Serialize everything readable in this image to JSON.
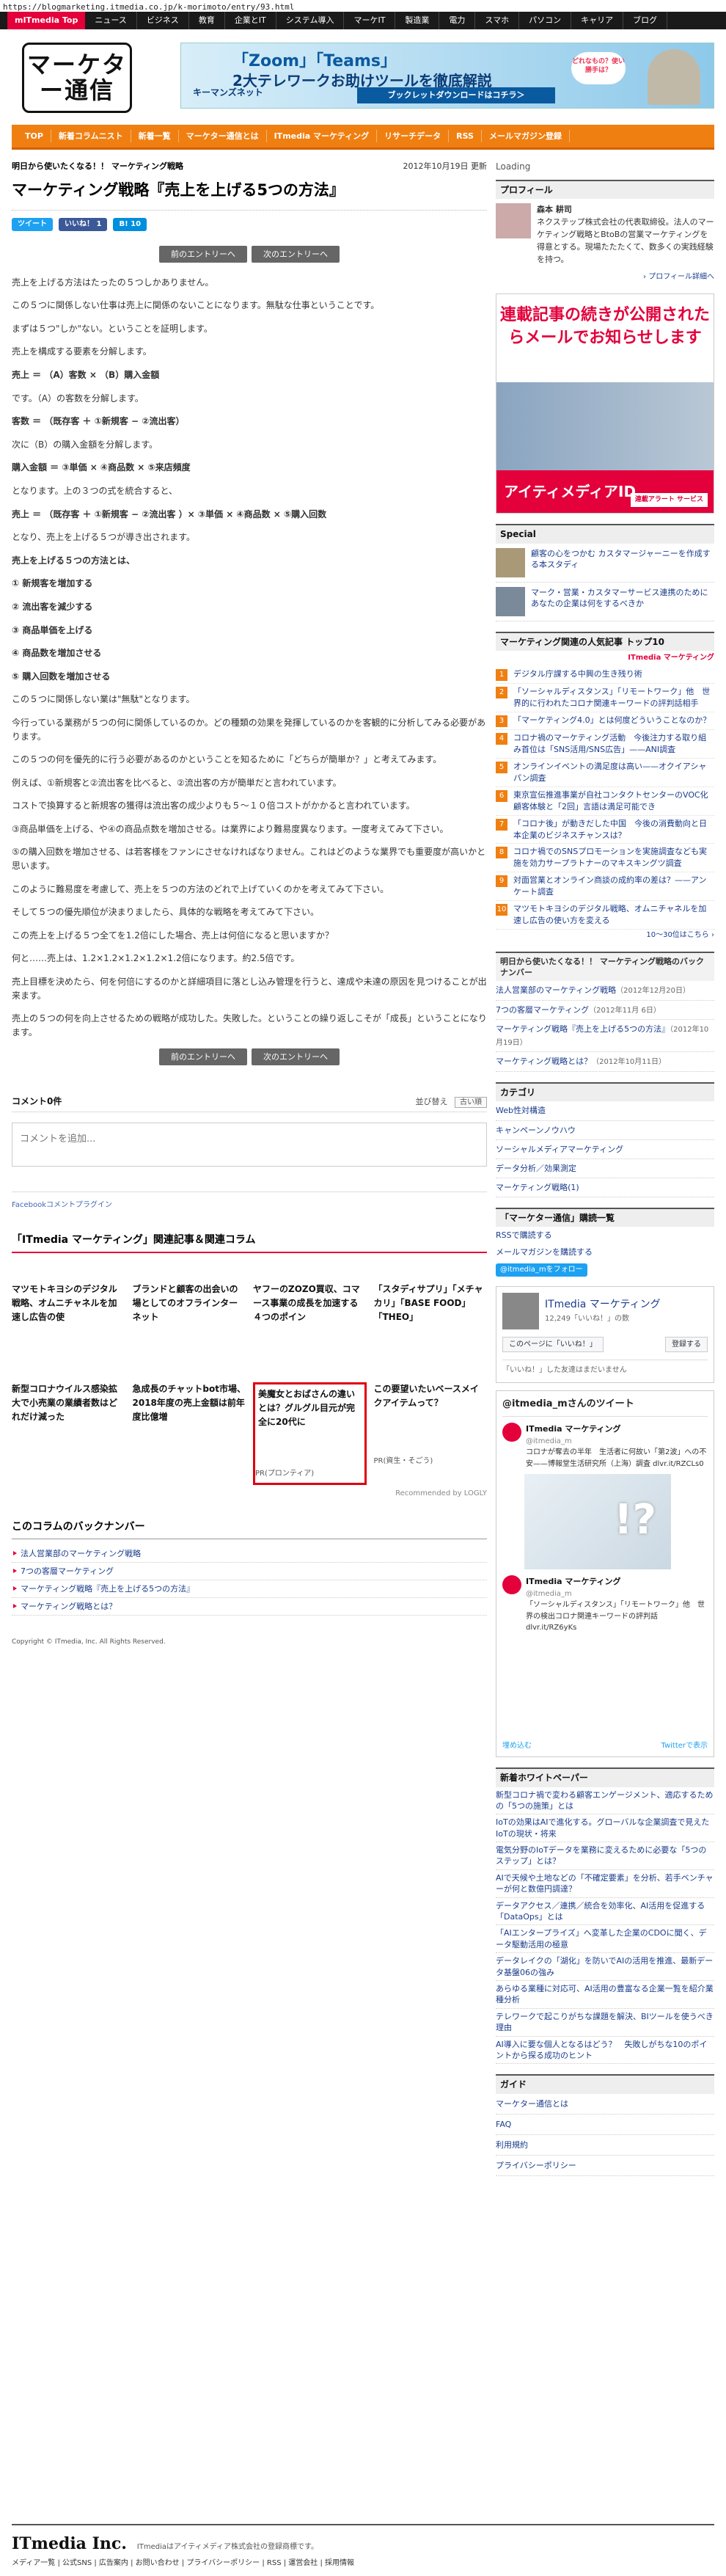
{
  "url": "https://blogmarketing.itmedia.co.jp/k-morimoto/entry/93.html",
  "topnav": {
    "home": "mITmedia Top",
    "links": [
      "ニュース",
      "ビジネス",
      "教育",
      "企業とIT",
      "システム導入",
      "マーケIT",
      "製造業",
      "電力",
      "スマホ",
      "パソコン",
      "キャリア",
      "ブログ"
    ]
  },
  "logo": "マーケター通信",
  "banner_top": {
    "line1": "「Zoom」「Teams」",
    "line2": "2大テレワークお助けツールを徹底解説",
    "brand": "キーマンズネット",
    "cta": "ブックレットダウンロードはコチラ＞",
    "bubble": "どれなもの？使い勝手は？"
  },
  "catnav": [
    "TOP",
    "新着コラムニスト",
    "新着一覧",
    "マーケター通信とは",
    "ITmedia マーケティング",
    "リサーチデータ",
    "RSS",
    "メールマガジン登録"
  ],
  "article": {
    "subtitle": "明日から使いたくなる！！ マーケティング戦略",
    "date": "2012年10月19日 更新",
    "title": "マーケティング戦略『売上を上げる5つの方法』",
    "share": {
      "tweet": "ツイート",
      "like": "いいね！ 1",
      "hatena": "B! 10"
    },
    "prev": "前のエントリーへ",
    "next": "次のエントリーへ",
    "paragraphs": [
      {
        "t": "売上を上げる方法はたったの５つしかありません。",
        "b": false
      },
      {
        "t": "この５つに関係しない仕事は売上に関係のないことになります。無駄な仕事ということです。",
        "b": false
      },
      {
        "t": "まずは５つ\"しか\"ない。ということを証明します。",
        "b": false
      },
      {
        "t": "売上を構成する要素を分解します。",
        "b": false
      },
      {
        "t": "売上 ＝ （A）客数 × （B）購入金額",
        "b": true
      },
      {
        "t": "です。（A）の客数を分解します。",
        "b": false
      },
      {
        "t": "客数 ＝ （既存客 ＋ ①新規客 − ②流出客）",
        "b": true
      },
      {
        "t": "次に（B）の購入金額を分解します。",
        "b": false
      },
      {
        "t": "購入金額 ＝ ③単価 × ④商品数 × ⑤来店頻度",
        "b": true
      },
      {
        "t": "となります。上の３つの式を統合すると、",
        "b": false
      },
      {
        "t": "売上 ＝ （既存客 ＋ ①新規客 − ②流出客 ）× ③単価 × ④商品数 × ⑤購入回数",
        "b": true
      },
      {
        "t": "となり、売上を上げる５つが導き出されます。",
        "b": false
      },
      {
        "t": "売上を上げる５つの方法とは、",
        "b": true
      },
      {
        "t": "① 新規客を増加する",
        "b": true
      },
      {
        "t": "② 流出客を減少する",
        "b": true
      },
      {
        "t": "③ 商品単価を上げる",
        "b": true
      },
      {
        "t": "④ 商品数を増加させる",
        "b": true
      },
      {
        "t": "⑤ 購入回数を増加させる",
        "b": true
      },
      {
        "t": "この５つに関係しない業は\"無駄\"となります。",
        "b": false
      },
      {
        "t": "今行っている業務が５つの何に関係しているのか。どの種類の効果を発揮しているのかを客観的に分析してみる必要があります。",
        "b": false
      },
      {
        "t": "この５つの何を優先的に行う必要があるのかということを知るために「どちらが簡単か？」と考えてみます。",
        "b": false
      },
      {
        "t": "例えば、①新規客と②流出客を比べると、②流出客の方が簡単だと言われています。",
        "b": false
      },
      {
        "t": "コストで換算すると新規客の獲得は流出客の成少よりも５〜１０倍コストがかかると言われています。",
        "b": false
      },
      {
        "t": "③商品単価を上げる、や④の商品点数を増加させる。は業界により難易度異なります。一度考えてみて下さい。",
        "b": false
      },
      {
        "t": "⑤の購入回数を増加させる、は若客様をファンにさせなければなりません。これはどのような業界でも重要度が高いかと思います。",
        "b": false
      },
      {
        "t": "このように難易度を考慮して、売上を５つの方法のどれで上げていくのかを考えてみて下さい。",
        "b": false
      },
      {
        "t": "そして５つの優先順位が決まりましたら、具体的な戦略を考えてみて下さい。",
        "b": false
      },
      {
        "t": "この売上を上げる５つ全てを1.2倍にした場合、売上は何倍になると思いますか？",
        "b": false
      },
      {
        "t": "何と……売上は、1.2×1.2×1.2×1.2×1.2倍になります。約2.5倍です。",
        "b": false
      },
      {
        "t": "売上目標を決めたら、何を何倍にするのかと詳細項目に落とし込み管理を行うと、達成や未達の原因を見つけることが出来ます。",
        "b": false
      },
      {
        "t": "売上の５つの何を向上させるための戦略が成功した。失敗した。ということの繰り返しこそが「成長」ということになります。",
        "b": false
      }
    ]
  },
  "comments": {
    "count": "コメント0件",
    "sort_label": "並び替え",
    "sort_value": "古い順",
    "placeholder": "コメントを追加...",
    "plugin": "Facebookコメントプラグイン"
  },
  "related": {
    "title": "「ITmedia マーケティング」関連記事＆関連コラム",
    "items": [
      {
        "t": "マツモトキヨシのデジタル戦略、オムニチャネルを加速し広告の使",
        "s": ""
      },
      {
        "t": "ブランドと顧客の出会いの場としてのオフラインターネット",
        "s": ""
      },
      {
        "t": "ヤフーのZOZO買収、コマース事業の成長を加速する４つのポイン",
        "s": ""
      },
      {
        "t": "「スタディサプリ」「メチャカリ」「BASE FOOD」「THEO」",
        "s": ""
      },
      {
        "t": "新型コロナウイルス感染拡大で小売業の業績者数はどれだけ減った",
        "s": ""
      },
      {
        "t": "急成長のチャットbot市場、2018年度の売上金額は前年度比億増",
        "s": ""
      },
      {
        "t": "美魔女とおばさんの違いとは？グルグル目元が完全に20代に",
        "s": "PR(プロンティア)"
      },
      {
        "t": "この要望いたいベースメイクアイテムって？",
        "s": "PR(資生・そごう)"
      }
    ],
    "recommend": "Recommended by  LOGLY"
  },
  "backnum": {
    "title": "このコラムのバックナンバー",
    "items": [
      "法人営業部のマーケティング戦略",
      "7つの客層マーケティング",
      "マーケティング戦略『売上を上げる5つの方法』",
      "マーケティング戦略とは？"
    ]
  },
  "copyright": "Copyright © ITmedia, Inc. All Rights Reserved.",
  "side": {
    "loading": "Loading",
    "profile_head": "プロフィール",
    "profile_name": "森本 耕司",
    "profile_text": "ネクステップ株式会社の代表取締役。法人のマーケティング戦略とBtoBの営業マーケティングを得意とする。現場たたたくて、数多くの実践経験を持つ。",
    "profile_more": "› プロフィール詳細へ",
    "ad_top": "連載記事の続きが公開されたらメールでお知らせします",
    "ad_bottom": "アイティメディアID",
    "ad_badge": "連載アラート サービス",
    "special_head": "Special",
    "special": [
      "顧客の心をつかむ カスタマージャーニーを作成する本スタディ",
      "マーク・営業・カスタマーサービス連携のためにあなたの企業は何をするべきか"
    ],
    "rank_head": "マーケティング関連の人気記事 トップ10",
    "rank_brand": "ITmedia マーケティング",
    "rank": [
      "デジタル庁課する中興の生き残り術",
      "「ソーシャルディスタンス」「リモートワーク」他　世界的に行われたコロナ関連キーワードの評判話相手",
      "「マーケティング4.0」とは何度どういうことなのか？",
      "コロナ禍のマーケティング活動　今後注力する取り組み首位は「SNS活用/SNS広告」——ANI調査",
      "オンラインイベントの満足度は高い——オクイアシャパン調査",
      "東京宣伝推進事業が自社コンタクトセンターのVOC化　顧客体験と「2回」言語は満足可能でき",
      "「コロナ後」が動きだした中国　今後の消費動向と日本企業のビジネスチャンスは？",
      "コロナ禍でのSNSプロモーションを実施調査なども実施を効力サープラトナーのマキスキングツ調査",
      "対面営業とオンライン商談の成約率の差は？——アンケート調査",
      "マツモトキヨシのデジタル戦略、オムニチャネルを加速し広告の使い方を変える"
    ],
    "rank_more": "10～30位はこちら ›",
    "series_head": "明日から使いたくなる！！ マーケティング戦略のバックナンバー",
    "series": [
      {
        "t": "法人営業部のマーケティング戦略",
        "d": "（2012年12月20日）"
      },
      {
        "t": "7つの客層マーケティング",
        "d": "（2012年11月 6日）"
      },
      {
        "t": "マーケティング戦略『売上を上げる5つの方法』",
        "d": "（2012年10月19日）"
      },
      {
        "t": "マーケティング戦略とは？",
        "d": "（2012年10月11日）"
      }
    ],
    "category_head": "カテゴリ",
    "categories": [
      "Web性対構造",
      "キャンペーンノウハウ",
      "ソーシャルメディアマーケティング",
      "データ分析／効果測定",
      "マーケティング戦略(1)"
    ],
    "sub_head": "「マーケター通信」購読一覧",
    "subs": [
      "RSSで購読する",
      "メールマガジンを購読する"
    ],
    "tw_follow": "@itmedia_mをフォロー",
    "fb_name": "ITmedia マーケティング",
    "fb_count": "12,249「いいね！」の数",
    "fb_like": "このページに「いいね！」",
    "fb_share": "登録する",
    "fb_note": "「いいね！」した友達はまだいません",
    "tw_head": "@itmedia_mさんのツイート",
    "tweets": [
      {
        "name": "ITmedia マーケティング",
        "handle": "@itmedia_m",
        "text": "コロナが奪去の半年　生活者に何故い「第2波」への不安——博報堂生活研究所（上海）調査 dlvr.it/RZCLs0"
      },
      {
        "name": "ITmedia マーケティング",
        "handle": "@itmedia_m",
        "text": "「ソーシャルディスタンス」「リモートワーク」他　世界の検出コロナ関連キーワードの評判話 dlvr.it/RZ6yKs"
      }
    ],
    "tw_embed": "埋め込む",
    "tw_view": "Twitterで表示",
    "wp_head": "新着ホワイトペーパー",
    "whitepapers": [
      "新型コロナ禍で変わる顧客エンゲージメント、適応するための「5つの施策」とは",
      "IoTの効果はAIで進化する。グローバルな企業調査で見えたIoTの現状・将来",
      "電気分野のIoTデータを業務に変えるために必要な「5つのステップ」とは？",
      "AIで天候や土地などの「不確定要素」を分析、若手ベンチャーが何と数億円調達？",
      "データアクセス／連携／統合を効率化、AI活用を促進する「DataOps」とは",
      "「AIエンタープライズ」へ変革した企業のCDOに聞く、データ駆動活用の極意",
      "データレイクの「湖化」を防いでAIの活用を推進、最新データ基盤06の強み",
      "あらゆる業種に対応可、AI活用の豊富なる企業一覧を紹介業種分析",
      "テレワークで起こりがちな課題を解決、BIツールを使うべき理由",
      "AI導入に要な個人となるはどう？　失敗しがちな10のポイントから探る成功のヒント"
    ],
    "guide_head": "ガイド",
    "guide": [
      "マーケター通信とは",
      "FAQ",
      "利用規約",
      "プライバシーポリシー"
    ]
  },
  "footer": {
    "logo": "ITmedia Inc.",
    "caption": "ITmediaはアイティメディア株式会社の登録商標です。",
    "links": "メディア一覧 | 公式SNS | 広告案内 | お問い合わせ | プライバシーポリシー | RSS | 運営会社 | 採用情報"
  }
}
